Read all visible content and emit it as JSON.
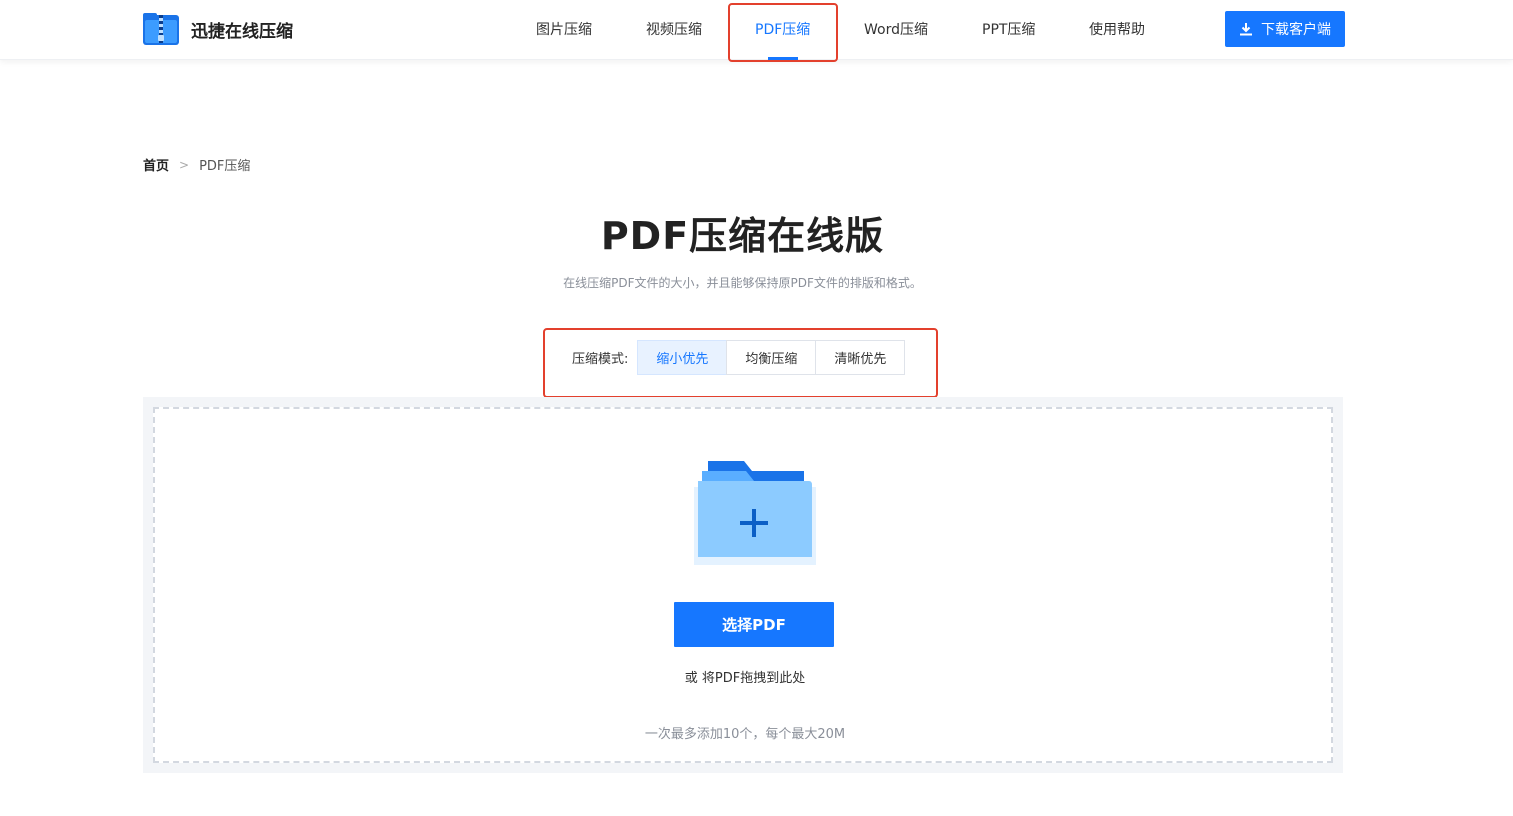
{
  "brand": {
    "name": "迅捷在线压缩",
    "logo_icon": "zip-file-icon"
  },
  "nav": {
    "items": [
      {
        "label": "图片压缩",
        "active": false
      },
      {
        "label": "视频压缩",
        "active": false
      },
      {
        "label": "PDF压缩",
        "active": true
      },
      {
        "label": "Word压缩",
        "active": false
      },
      {
        "label": "PPT压缩",
        "active": false
      },
      {
        "label": "使用帮助",
        "active": false
      }
    ],
    "download_label": "下载客户端",
    "download_icon": "download-icon"
  },
  "breadcrumb": {
    "home": "首页",
    "current": "PDF压缩"
  },
  "page": {
    "title": "PDF压缩在线版",
    "subtitle": "在线压缩PDF文件的大小，并且能够保持原PDF文件的排版和格式。"
  },
  "compression_mode": {
    "label": "压缩模式:",
    "options": [
      "缩小优先",
      "均衡压缩",
      "清晰优先"
    ],
    "selected": "缩小优先"
  },
  "upload": {
    "folder_icon": "folder-add-icon",
    "button_label": "选择PDF",
    "drag_hint": "或 将PDF拖拽到此处",
    "limit_hint": "一次最多添加10个，每个最大20M"
  },
  "colors": {
    "accent": "#1677ff",
    "highlight": "#e3402d",
    "upload_bg": "#f3f5f8"
  }
}
